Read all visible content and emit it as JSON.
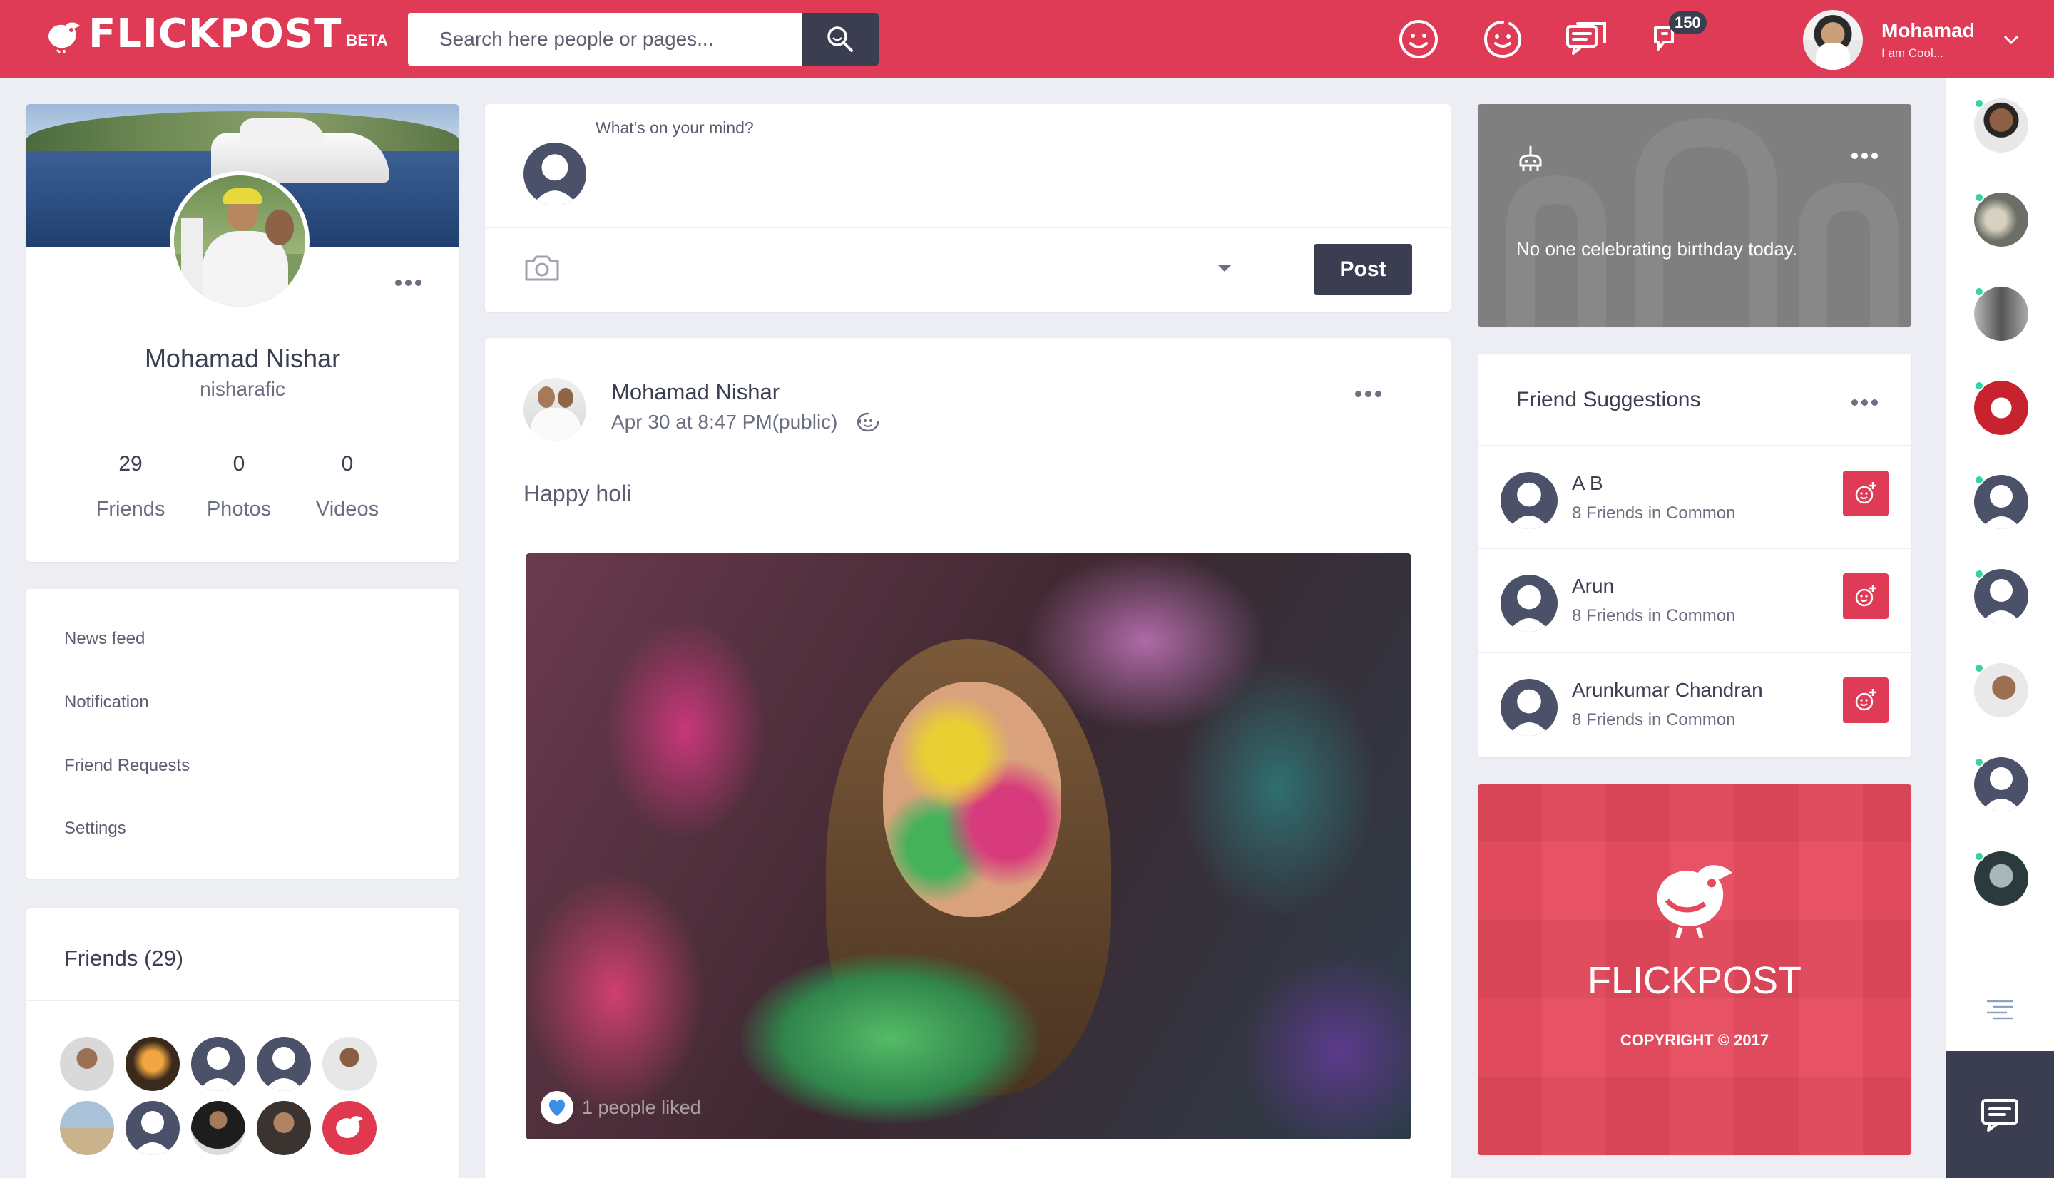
{
  "header": {
    "logo_text": "FLICKPOST",
    "logo_badge": "BETA",
    "search_placeholder": "Search here people or pages...",
    "notification_count": "150",
    "user_name": "Mohamad",
    "user_status": "I am Cool..."
  },
  "profile": {
    "name": "Mohamad Nishar",
    "handle": "nisharafic",
    "stats": [
      {
        "value": "29",
        "label": "Friends"
      },
      {
        "value": "0",
        "label": "Photos"
      },
      {
        "value": "0",
        "label": "Videos"
      }
    ]
  },
  "nav": {
    "items": [
      "News feed",
      "Notification",
      "Friend Requests",
      "Settings"
    ]
  },
  "friends": {
    "title": "Friends (29)"
  },
  "composer": {
    "prompt": "What's on your mind?",
    "post_label": "Post"
  },
  "post": {
    "author": "Mohamad Nishar",
    "time": "Apr 30 at 8:47 PM(public)",
    "text": "Happy holi",
    "likes": "1 people liked"
  },
  "birthday": {
    "text": "No one celebrating birthday today."
  },
  "suggestions": {
    "title": "Friend Suggestions",
    "items": [
      {
        "name": "A B",
        "common": "8 Friends in Common"
      },
      {
        "name": "Arun",
        "common": "8 Friends in Common"
      },
      {
        "name": "Arunkumar Chandran",
        "common": "8 Friends in Common"
      }
    ]
  },
  "promo": {
    "brand": "FLICKPOST",
    "copyright": "COPYRIGHT © 2017"
  },
  "colors": {
    "brand": "#df3a56",
    "dark": "#3b3e51",
    "online": "#3ad2a5"
  }
}
